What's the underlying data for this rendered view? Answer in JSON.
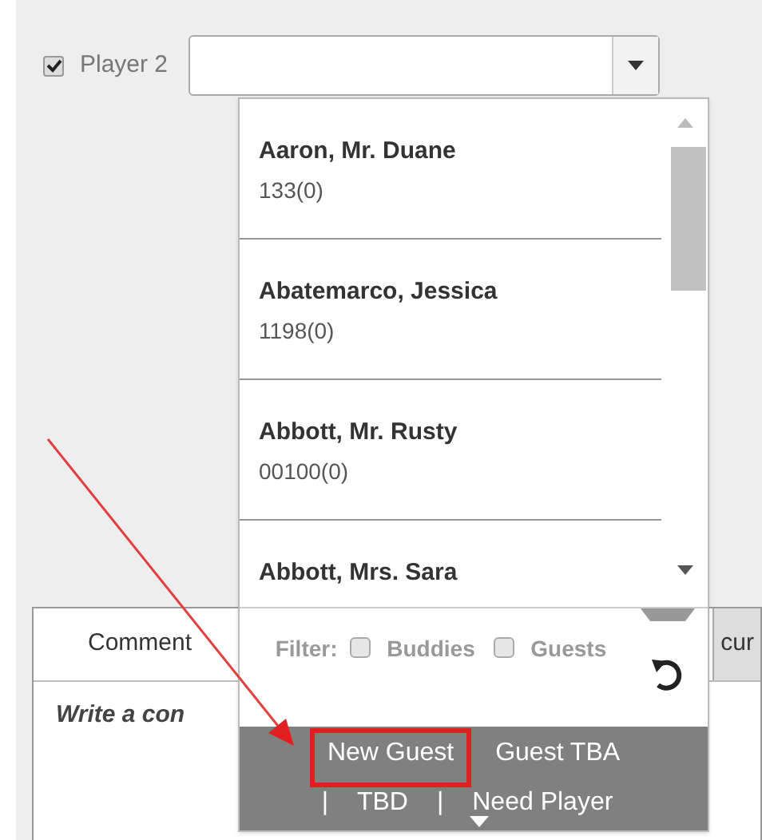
{
  "player_row": {
    "checked": true,
    "label": "Player 2"
  },
  "comments_panel": {
    "tabs": [
      {
        "label": "Comment",
        "selected": true
      },
      {
        "label": "cur",
        "selected": false
      }
    ],
    "prompt": "Write a con"
  },
  "dropdown": {
    "options": [
      {
        "name": "Aaron, Mr. Duane",
        "code": "133(0)"
      },
      {
        "name": "Abatemarco, Jessica",
        "code": "1198(0)"
      },
      {
        "name": "Abbott, Mr. Rusty",
        "code": "00100(0)"
      },
      {
        "name": "Abbott, Mrs. Sara"
      }
    ],
    "filter": {
      "label": "Filter:",
      "options": [
        {
          "label": "Buddies",
          "checked": false
        },
        {
          "label": "Guests",
          "checked": false
        }
      ]
    },
    "actions": [
      {
        "kind": "link",
        "text": "New Guest",
        "highlighted": true
      },
      {
        "kind": "link",
        "text": "Guest TBA",
        "highlighted": false
      },
      {
        "kind": "separator",
        "text": "|"
      },
      {
        "kind": "link",
        "text": "TBD",
        "highlighted": false
      },
      {
        "kind": "separator",
        "text": "|"
      },
      {
        "kind": "link",
        "text": "Need Player",
        "highlighted": false
      }
    ]
  }
}
